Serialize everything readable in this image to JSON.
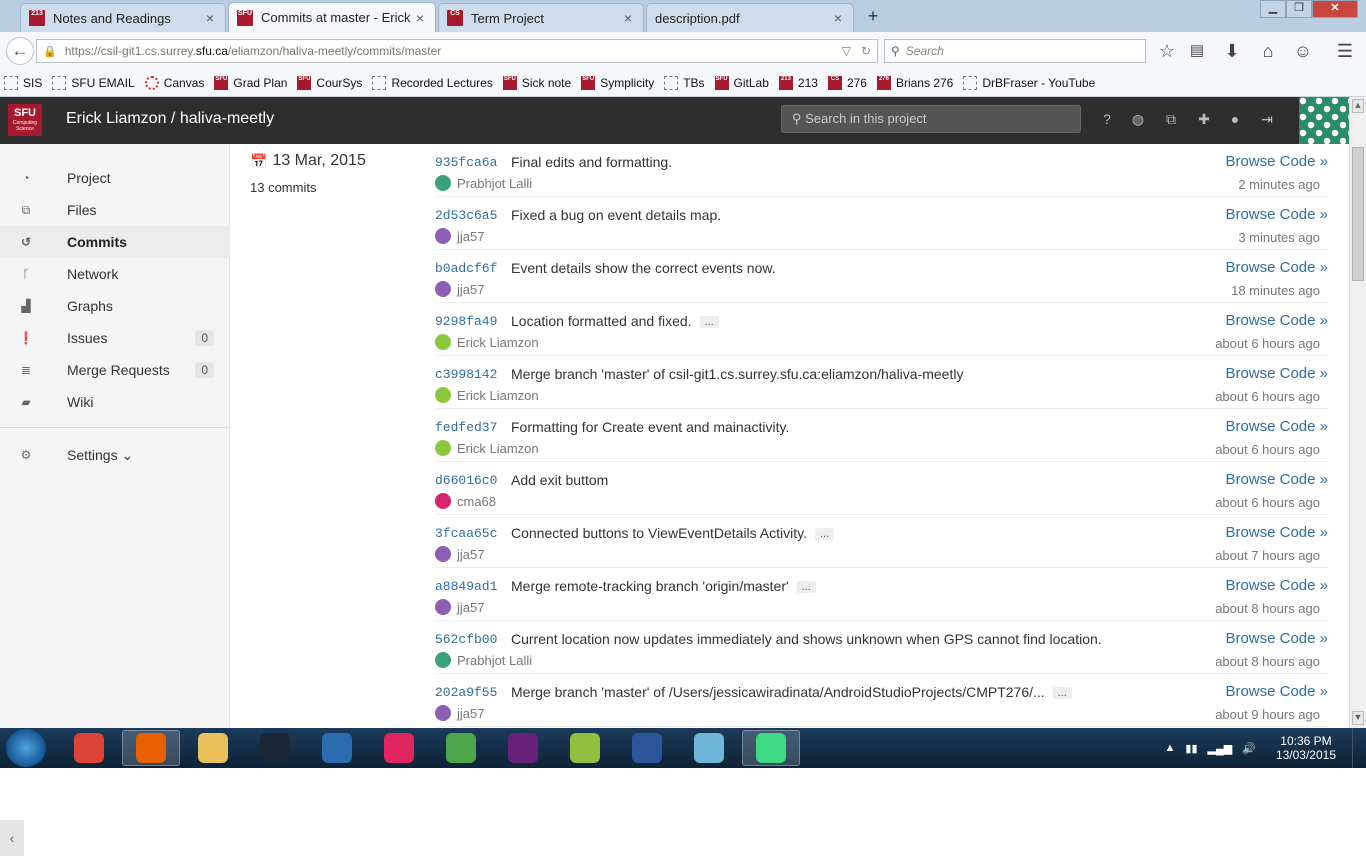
{
  "browser": {
    "tabs": [
      {
        "title": "Notes and Readings",
        "favicon": "213-icon",
        "close": "×"
      },
      {
        "title": "Commits at master - Erick ...",
        "favicon": "sfu-icon",
        "close": "×"
      },
      {
        "title": "Term Project",
        "favicon": "cs-icon",
        "close": "×"
      },
      {
        "title": "description.pdf",
        "favicon": "",
        "close": "×"
      }
    ],
    "new_tab": "+",
    "url": {
      "prefix": "https://csil-git1.cs.surrey.",
      "host": "sfu.ca",
      "suffix": "/eliamzon/haliva-meetly/commits/master"
    },
    "search_placeholder": "Search",
    "bookmarks": [
      {
        "label": "SIS",
        "icon": "page-icon"
      },
      {
        "label": "SFU EMAIL",
        "icon": "page-icon"
      },
      {
        "label": "Canvas",
        "icon": "canvas-icon"
      },
      {
        "label": "Grad Plan",
        "icon": "sfu-icon"
      },
      {
        "label": "CourSys",
        "icon": "sfu-icon"
      },
      {
        "label": "Recorded Lectures",
        "icon": "page-icon"
      },
      {
        "label": "Sick note",
        "icon": "sfu-icon"
      },
      {
        "label": "Symplicity",
        "icon": "sfu-icon"
      },
      {
        "label": "TBs",
        "icon": "page-icon"
      },
      {
        "label": "GitLab",
        "icon": "sfu-icon"
      },
      {
        "label": "213",
        "icon": "sfu-icon"
      },
      {
        "label": "276",
        "icon": "sfu-icon"
      },
      {
        "label": "Brians 276",
        "icon": "sfu-icon"
      },
      {
        "label": "DrBFraser - YouTube",
        "icon": "page-icon"
      }
    ]
  },
  "gitlab": {
    "logo_text": "SFU",
    "logo_sub": "Computing Science",
    "title": "Erick Liamzon / haliva-meetly",
    "search_placeholder": "Search in this project",
    "header_icons": [
      "help-icon",
      "globe-icon",
      "copy-icon",
      "plus-icon",
      "user-icon",
      "logout-icon"
    ]
  },
  "sidebar": {
    "items": [
      {
        "label": "Project",
        "icon": "dashboard-icon",
        "count": ""
      },
      {
        "label": "Files",
        "icon": "files-icon",
        "count": ""
      },
      {
        "label": "Commits",
        "icon": "history-icon",
        "count": "",
        "active": true
      },
      {
        "label": "Network",
        "icon": "branch-icon",
        "count": ""
      },
      {
        "label": "Graphs",
        "icon": "chart-icon",
        "count": ""
      },
      {
        "label": "Issues",
        "icon": "exclamation-icon",
        "count": "0"
      },
      {
        "label": "Merge Requests",
        "icon": "list-icon",
        "count": "0"
      },
      {
        "label": "Wiki",
        "icon": "book-icon",
        "count": ""
      }
    ],
    "settings_label": "Settings ⌄",
    "collapse": "‹"
  },
  "commits_day": {
    "date": "13 Mar, 2015",
    "count_label": "13 commits",
    "browse_label": "Browse Code »",
    "commits": [
      {
        "sha": "935fca6a",
        "message": "Final edits and formatting.",
        "more": false,
        "author": "Prabhjot Lalli",
        "avatar_color": "#3aa27a",
        "time": "2 minutes ago"
      },
      {
        "sha": "2d53c6a5",
        "message": "Fixed a bug on event details map.",
        "more": false,
        "author": "jja57",
        "avatar_color": "#8c5fb5",
        "time": "3 minutes ago"
      },
      {
        "sha": "b0adcf6f",
        "message": "Event details show the correct events now.",
        "more": false,
        "author": "jja57",
        "avatar_color": "#8c5fb5",
        "time": "18 minutes ago"
      },
      {
        "sha": "9298fa49",
        "message": "Location formatted and fixed.",
        "more": true,
        "author": "Erick Liamzon",
        "avatar_color": "#8dc63f",
        "time": "about 6 hours ago"
      },
      {
        "sha": "c3998142",
        "message": "Merge branch 'master' of csil-git1.cs.surrey.sfu.ca:eliamzon/haliva-meetly",
        "more": false,
        "author": "Erick Liamzon",
        "avatar_color": "#8dc63f",
        "time": "about 6 hours ago"
      },
      {
        "sha": "fedfed37",
        "message": "Formatting for Create event and mainactivity.",
        "more": false,
        "author": "Erick Liamzon",
        "avatar_color": "#8dc63f",
        "time": "about 6 hours ago"
      },
      {
        "sha": "d66016c0",
        "message": "Add exit buttom",
        "more": false,
        "author": "cma68",
        "avatar_color": "#d6246e",
        "time": "about 6 hours ago"
      },
      {
        "sha": "3fcaa65c",
        "message": "Connected buttons to ViewEventDetails Activity.",
        "more": true,
        "author": "jja57",
        "avatar_color": "#8c5fb5",
        "time": "about 7 hours ago"
      },
      {
        "sha": "a8849ad1",
        "message": "Merge remote-tracking branch 'origin/master'",
        "more": true,
        "author": "jja57",
        "avatar_color": "#8c5fb5",
        "time": "about 8 hours ago"
      },
      {
        "sha": "562cfb00",
        "message": "Current location now updates immediately and shows unknown when GPS cannot find location.",
        "more": false,
        "author": "Prabhjot Lalli",
        "avatar_color": "#3aa27a",
        "time": "about 8 hours ago"
      },
      {
        "sha": "202a9f55",
        "message": "Merge branch 'master' of /Users/jessicawiradinata/AndroidStudioProjects/CMPT276/...",
        "more": true,
        "author": "jja57",
        "avatar_color": "#8c5fb5",
        "time": "about 9 hours ago"
      }
    ],
    "more_label": "..."
  },
  "taskbar": {
    "apps": [
      {
        "name": "chrome-icon",
        "color": "#db4437",
        "running": false
      },
      {
        "name": "firefox-icon",
        "color": "#e66000",
        "running": true
      },
      {
        "name": "explorer-icon",
        "color": "#e8c15a",
        "running": false
      },
      {
        "name": "steam-icon",
        "color": "#1b2838",
        "running": false
      },
      {
        "name": "app-icon",
        "color": "#2b6cb0",
        "running": false
      },
      {
        "name": "itunes-icon",
        "color": "#e0245e",
        "running": false
      },
      {
        "name": "utorrent-icon",
        "color": "#4ca64c",
        "running": false
      },
      {
        "name": "visual-studio-icon",
        "color": "#68217a",
        "running": false
      },
      {
        "name": "notepad-icon",
        "color": "#8fbf3f",
        "running": false
      },
      {
        "name": "word-icon",
        "color": "#2b579a",
        "running": false
      },
      {
        "name": "app2-icon",
        "color": "#6fb7d9",
        "running": false
      },
      {
        "name": "android-studio-icon",
        "color": "#3ddc84",
        "running": true
      }
    ],
    "time": "10:36 PM",
    "date": "13/03/2015"
  }
}
